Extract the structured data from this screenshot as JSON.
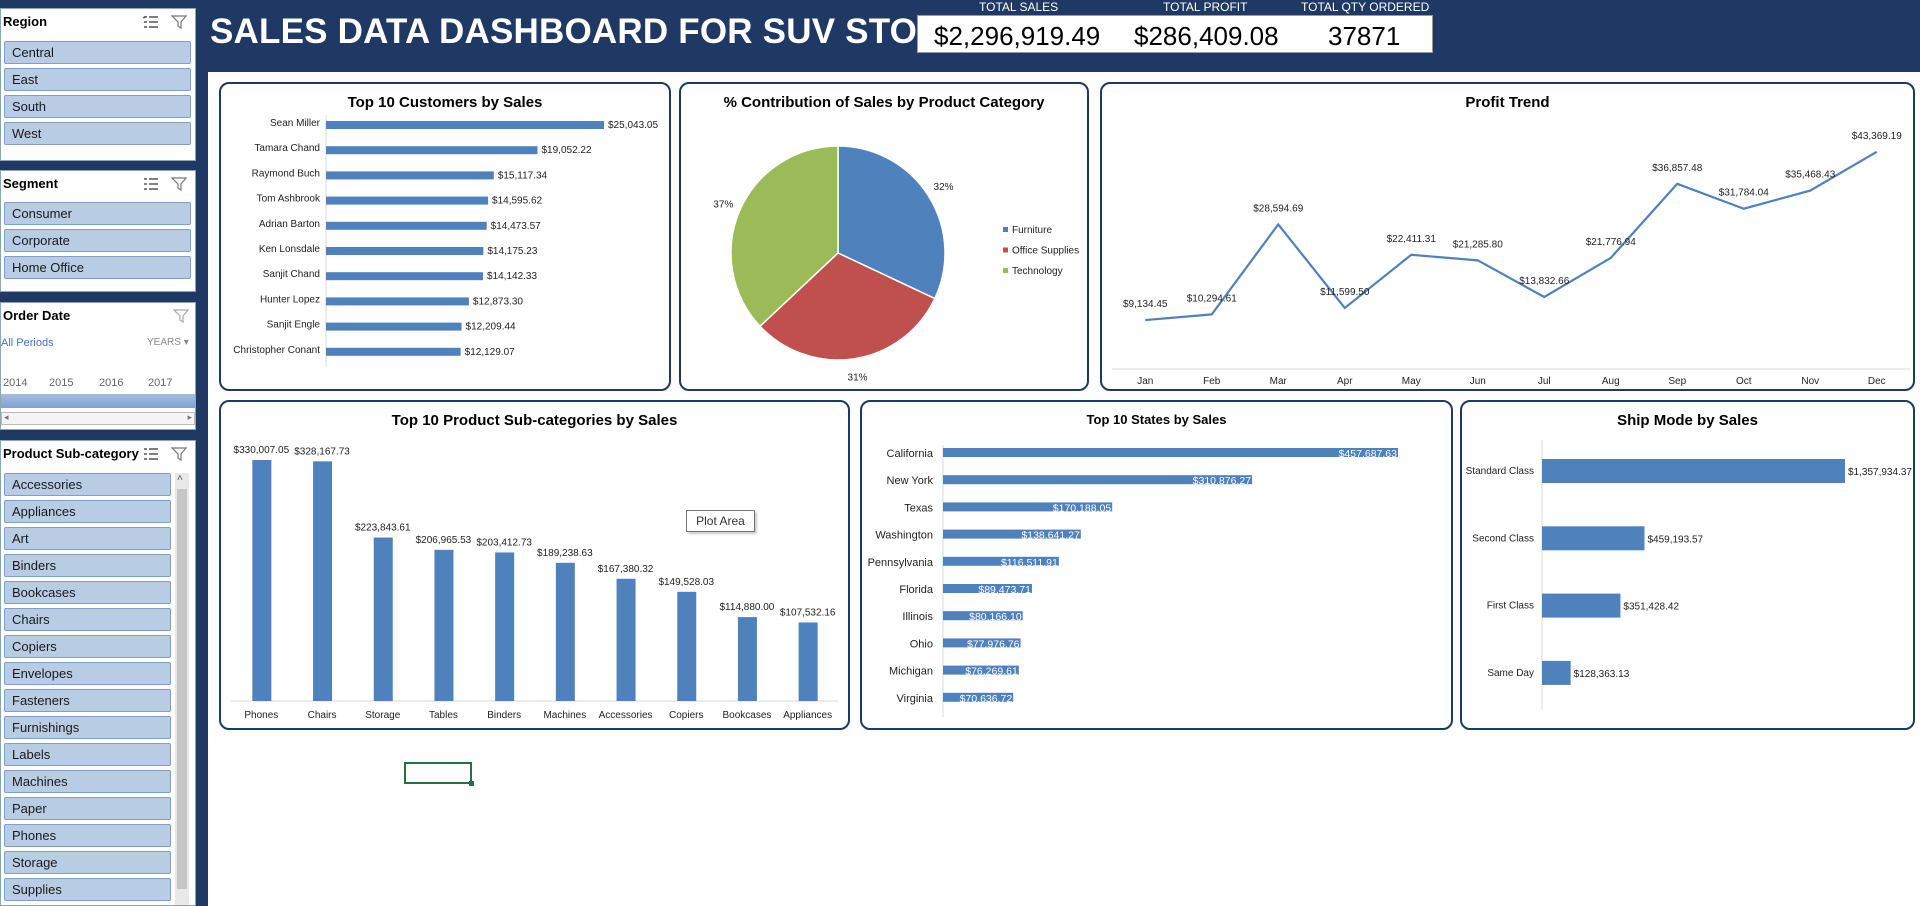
{
  "dashboard_title": "SALES DATA DASHBOARD FOR SUV STORES",
  "kpis": {
    "sales_label": "TOTAL SALES",
    "sales_value": "$2,296,919.49",
    "profit_label": "TOTAL PROFIT",
    "profit_value": "$286,409.08",
    "qty_label": "TOTAL QTY ORDERED",
    "qty_value": "37871"
  },
  "slicers": {
    "region": {
      "title": "Region",
      "items": [
        "Central",
        "East",
        "South",
        "West"
      ]
    },
    "segment": {
      "title": "Segment",
      "items": [
        "Consumer",
        "Corporate",
        "Home Office"
      ]
    },
    "order_date": {
      "title": "Order Date",
      "period": "All Periods",
      "level": "YEARS",
      "years": [
        "2014",
        "2015",
        "2016",
        "2017"
      ]
    },
    "subcategory": {
      "title": "Product Sub-category",
      "items": [
        "Accessories",
        "Appliances",
        "Art",
        "Binders",
        "Bookcases",
        "Chairs",
        "Copiers",
        "Envelopes",
        "Fasteners",
        "Furnishings",
        "Labels",
        "Machines",
        "Paper",
        "Phones",
        "Storage",
        "Supplies"
      ]
    }
  },
  "tooltip": "Plot Area",
  "chart_data": [
    {
      "type": "bar",
      "title": "Top 10 Customers by Sales",
      "categories": [
        "Sean Miller",
        "Tamara Chand",
        "Raymond Buch",
        "Tom Ashbrook",
        "Adrian Barton",
        "Ken Lonsdale",
        "Sanjit Chand",
        "Hunter Lopez",
        "Sanjit Engle",
        "Christopher Conant"
      ],
      "values": [
        25043.05,
        19052.22,
        15117.34,
        14595.62,
        14473.57,
        14175.23,
        14142.33,
        12873.3,
        12209.44,
        12129.07
      ],
      "labels": [
        "$25,043.05",
        "$19,052.22",
        "$15,117.34",
        "$14,595.62",
        "$14,473.57",
        "$14,175.23",
        "$14,142.33",
        "$12,873.30",
        "$12,209.44",
        "$12,129.07"
      ],
      "color": "#4f81bd"
    },
    {
      "type": "pie",
      "title": "% Contribution of Sales by Product Category",
      "categories": [
        "Furniture",
        "Office Supplies",
        "Technology"
      ],
      "values": [
        32,
        31,
        37
      ],
      "labels": [
        "32%",
        "31%",
        "37%"
      ],
      "colors": [
        "#4f81bd",
        "#c0504d",
        "#9bbb59"
      ],
      "legend": "right"
    },
    {
      "type": "line",
      "title": "Profit Trend",
      "categories": [
        "Jan",
        "Feb",
        "Mar",
        "Apr",
        "May",
        "Jun",
        "Jul",
        "Aug",
        "Sep",
        "Oct",
        "Nov",
        "Dec"
      ],
      "values": [
        9134.45,
        10294.61,
        28594.69,
        11599.5,
        22411.31,
        21285.8,
        13832.66,
        21776.94,
        36857.48,
        31784.04,
        35468.43,
        43369.19
      ],
      "labels": [
        "$9,134.45",
        "$10,294.61",
        "$28,594.69",
        "$11,599.50",
        "$22,411.31",
        "$21,285.80",
        "$13,832.66",
        "$21,776.94",
        "$36,857.48",
        "$31,784.04",
        "$35,468.43",
        "$43,369.19"
      ],
      "color": "#4f81bd"
    },
    {
      "type": "bar",
      "title": "Top 10 Product Sub-categories by Sales",
      "categories": [
        "Phones",
        "Chairs",
        "Storage",
        "Tables",
        "Binders",
        "Machines",
        "Accessories",
        "Copiers",
        "Bookcases",
        "Appliances"
      ],
      "values": [
        330007.05,
        328167.73,
        223843.61,
        206965.53,
        203412.73,
        189238.63,
        167380.32,
        149528.03,
        114880.0,
        107532.16
      ],
      "labels": [
        "$330,007.05",
        "$328,167.73",
        "$223,843.61",
        "$206,965.53",
        "$203,412.73",
        "$189,238.63",
        "$167,380.32",
        "$149,528.03",
        "$114,880.00",
        "$107,532.16"
      ],
      "color": "#4f81bd"
    },
    {
      "type": "bar",
      "title": "Top 10 States by Sales",
      "categories": [
        "California",
        "New York",
        "Texas",
        "Washington",
        "Pennsylvania",
        "Florida",
        "Illinois",
        "Ohio",
        "Michigan",
        "Virginia"
      ],
      "values": [
        457687.63,
        310876.27,
        170188.05,
        138641.27,
        116511.91,
        89473.71,
        80166.1,
        77976.76,
        76269.61,
        70636.72
      ],
      "labels": [
        "$457,687.63",
        "$310,876.27",
        "$170,188.05",
        "$138,641.27",
        "$116,511.91",
        "$89,473.71",
        "$80,166.10",
        "$77,976.76",
        "$76,269.61",
        "$70,636.72"
      ],
      "color": "#4f81bd"
    },
    {
      "type": "bar",
      "title": "Ship Mode by Sales",
      "categories": [
        "Standard Class",
        "Second Class",
        "First Class",
        "Same Day"
      ],
      "values": [
        1357934.37,
        459193.57,
        351428.42,
        128363.13
      ],
      "labels": [
        "$1,357,934.37",
        "$459,193.57",
        "$351,428.42",
        "$128,363.13"
      ],
      "color": "#4f81bd"
    }
  ]
}
